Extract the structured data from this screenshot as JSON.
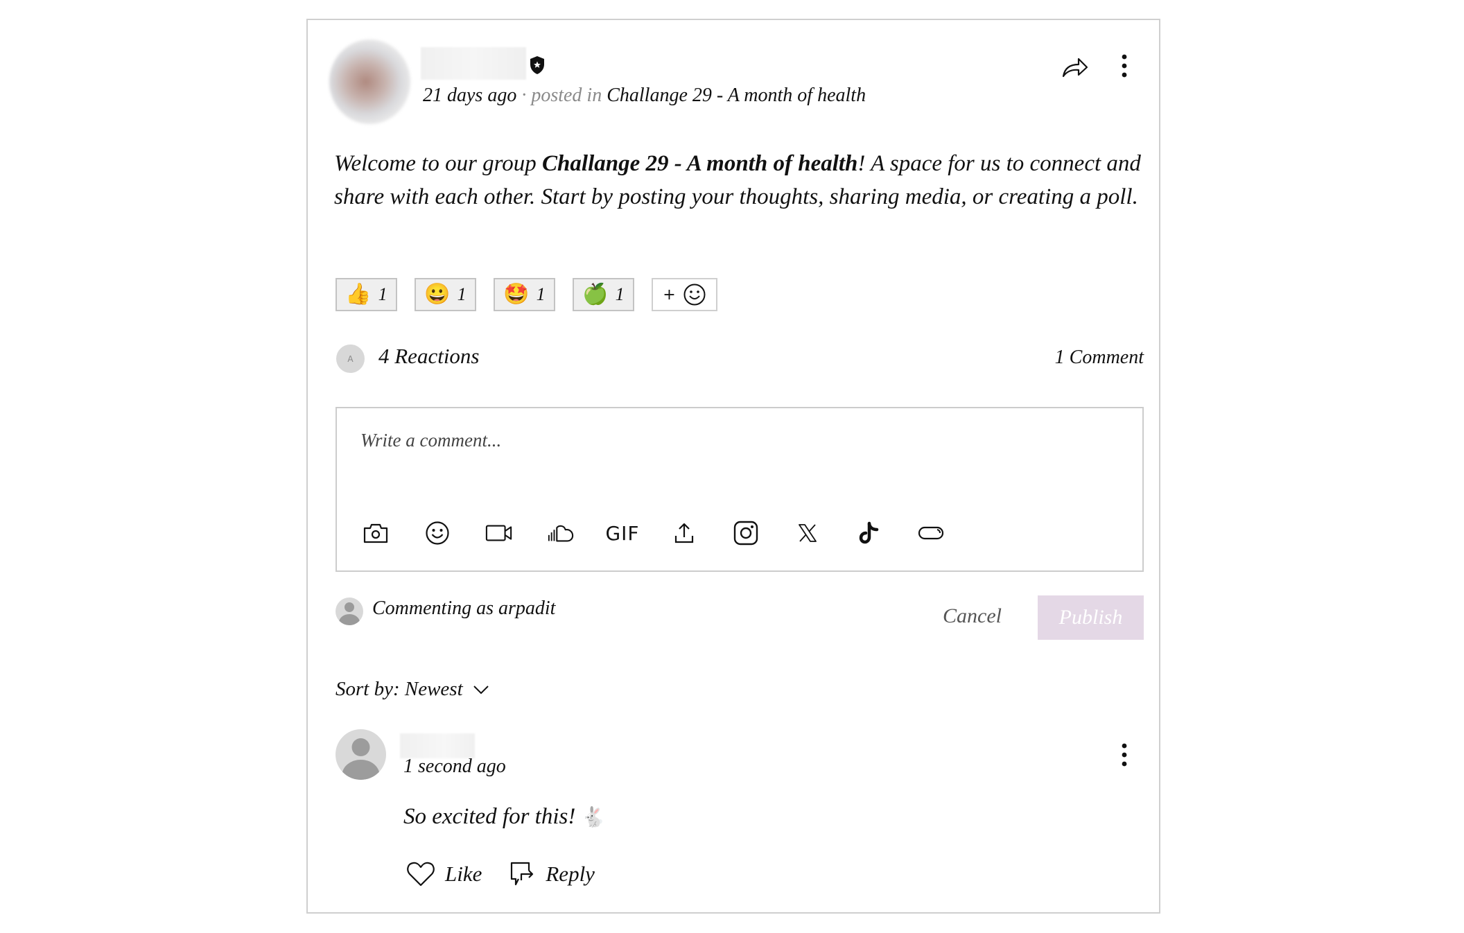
{
  "post": {
    "author_name_blurred": true,
    "badge_icon": "admin-shield-star-icon",
    "timestamp": "21 days ago",
    "separator": " · ",
    "posted_in_label": "posted in ",
    "group_name": "Challange 29 - A month of health",
    "body": {
      "prefix": "Welcome to our group ",
      "bold": "Challange 29 - A month of health",
      "suffix": "! A space for us to connect and share with each other. Start by posting your thoughts, sharing media, or creating a poll."
    },
    "actions": {
      "share_icon": "share-arrow-icon",
      "more_icon": "more-vertical-icon"
    }
  },
  "reactions": {
    "chips": [
      {
        "emoji": "👍",
        "name": "thumbs-up",
        "count": "1"
      },
      {
        "emoji": "😀",
        "name": "grinning-face",
        "count": "1"
      },
      {
        "emoji": "🤩",
        "name": "star-struck",
        "count": "1"
      },
      {
        "emoji": "🍏",
        "name": "green-apple",
        "count": "1"
      }
    ],
    "add_label": "+",
    "reactor_initial": "A",
    "summary": "4 Reactions",
    "comment_count": "1 Comment"
  },
  "composer": {
    "placeholder": "Write a comment...",
    "toolbar": [
      {
        "name": "camera-icon",
        "label": "Photo"
      },
      {
        "name": "emoji-icon",
        "label": "Emoji"
      },
      {
        "name": "video-icon",
        "label": "Video"
      },
      {
        "name": "soundcloud-icon",
        "label": "SoundCloud"
      },
      {
        "name": "gif-icon",
        "label": "GIF"
      },
      {
        "name": "upload-icon",
        "label": "Upload"
      },
      {
        "name": "instagram-icon",
        "label": "Instagram"
      },
      {
        "name": "x-twitter-icon",
        "label": "X"
      },
      {
        "name": "tiktok-icon",
        "label": "TikTok"
      },
      {
        "name": "embed-link-icon",
        "label": "Embed"
      }
    ],
    "gif_text": "GIF",
    "commenting_as": "Commenting as arpadit",
    "cancel_label": "Cancel",
    "publish_label": "Publish",
    "publish_color": "#e4d8e6"
  },
  "comments": {
    "sort_label": "Sort by: Newest",
    "items": [
      {
        "author_name_blurred": true,
        "time": "1 second ago",
        "text": "So excited for this! ",
        "emoji": "🐇",
        "like_label": "Like",
        "reply_label": "Reply"
      }
    ]
  }
}
